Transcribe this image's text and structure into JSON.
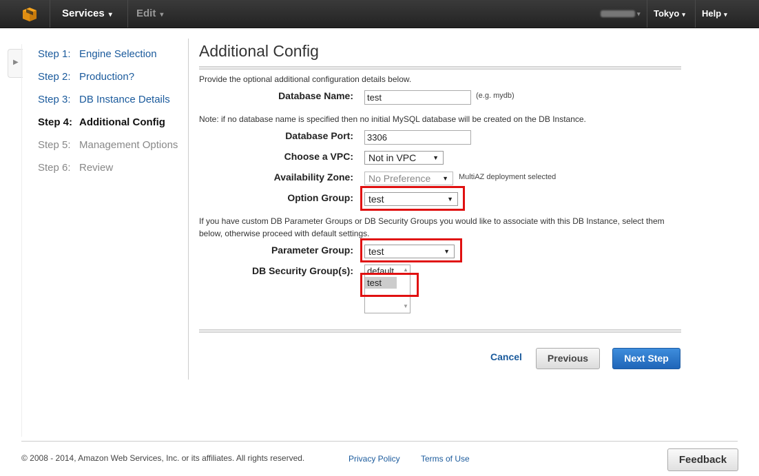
{
  "topbar": {
    "services_label": "Services",
    "edit_label": "Edit",
    "region_label": "Tokyo",
    "help_label": "Help"
  },
  "steps": [
    {
      "num": "Step 1:",
      "label": "Engine Selection"
    },
    {
      "num": "Step 2:",
      "label": "Production?"
    },
    {
      "num": "Step 3:",
      "label": "DB Instance Details"
    },
    {
      "num": "Step 4:",
      "label": "Additional Config"
    },
    {
      "num": "Step 5:",
      "label": "Management Options"
    },
    {
      "num": "Step 6:",
      "label": "Review"
    }
  ],
  "main": {
    "title": "Additional Config",
    "intro": "Provide the optional additional configuration details below.",
    "db_name_label": "Database Name:",
    "db_name_value": "test",
    "db_name_hint": "(e.g. mydb)",
    "db_name_note": "Note: if no database name is specified then no initial MySQL database will be created on the DB Instance.",
    "db_port_label": "Database Port:",
    "db_port_value": "3306",
    "vpc_label": "Choose a VPC:",
    "vpc_value": "Not in VPC",
    "az_label": "Availability Zone:",
    "az_value": "No Preference",
    "az_hint": "MultiAZ deployment selected",
    "option_group_label": "Option Group:",
    "option_group_value": "test",
    "param_note_line1": "If you have custom DB Parameter Groups or DB Security Groups you would like to associate with this DB Instance, select them",
    "param_note_line2": "below, otherwise proceed with default settings.",
    "param_group_label": "Parameter Group:",
    "param_group_value": "test",
    "sec_group_label": "DB Security Group(s):",
    "sec_group_options": [
      "default",
      "test"
    ]
  },
  "buttons": {
    "cancel": "Cancel",
    "previous": "Previous",
    "next": "Next Step"
  },
  "footer": {
    "copyright": "© 2008 - 2014, Amazon Web Services, Inc. or its affiliates. All rights reserved.",
    "privacy": "Privacy Policy",
    "terms": "Terms of Use",
    "feedback": "Feedback"
  },
  "colors": {
    "link": "#1a5a9c",
    "highlight": "#e01010",
    "primary_button": "#2a75c8"
  }
}
